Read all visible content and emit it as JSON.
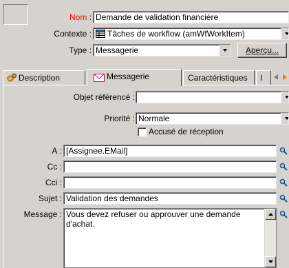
{
  "header": {
    "name_label": "Nom",
    "name_value": "Demande de validation financière",
    "context_label": "Contexte",
    "context_value": "Tâches de workflow (amWfWorkItem)",
    "type_label": "Type",
    "type_value": "Messagerie",
    "preview_label": "Aperçu..."
  },
  "tabs": [
    {
      "label": "Description",
      "icon": "gears-icon"
    },
    {
      "label": "Messagerie",
      "icon": "envelope-icon"
    },
    {
      "label": "Caractéristiques"
    },
    {
      "label": "I"
    }
  ],
  "form": {
    "referenced_object_label": "Objet référencé",
    "referenced_object_value": "",
    "priority_label": "Priorité",
    "priority_value": "Normale",
    "receipt_label": "Accusé de réception",
    "to_label": "A",
    "to_value": "[Assignee.EMail]",
    "cc_label": "Cc",
    "cc_value": "",
    "bcc_label": "Cci",
    "bcc_value": "",
    "subject_label": "Sujet",
    "subject_value": "Validation des demandes",
    "message_label": "Message",
    "message_value": "Vous devez refuser ou approuver une demande d'achat."
  },
  "colors": {
    "required_label": "#ff0000",
    "search_icon": "#1a4fa0"
  }
}
